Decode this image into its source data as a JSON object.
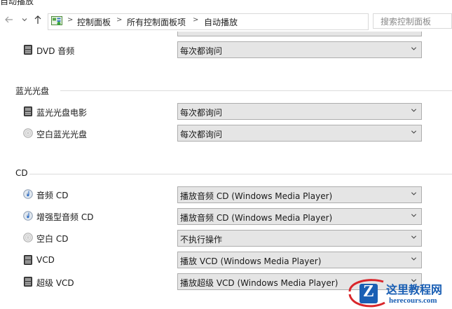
{
  "window": {
    "title_fragment": "自动播放"
  },
  "nav": {
    "back_icon": "back-arrow-icon",
    "forward_icon": "forward-arrow-icon",
    "recent_icon": "chevron-down-icon",
    "up_icon": "up-arrow-icon"
  },
  "address_bar": {
    "crumbs": [
      "控制面板",
      "所有控制面板项",
      "自动播放"
    ]
  },
  "search": {
    "placeholder": "搜索控制面板"
  },
  "sections": {
    "dvd": {
      "rows": [
        {
          "label": "DVD 音频",
          "value": "每次都询问",
          "icon": "dvd-drive-icon"
        }
      ]
    },
    "bluray": {
      "header": "蓝光光盘",
      "rows": [
        {
          "label": "蓝光光盘电影",
          "value": "每次都询问",
          "icon": "disc-drive-icon"
        },
        {
          "label": "空白蓝光光盘",
          "value": "每次都询问",
          "icon": "blank-disc-icon"
        }
      ]
    },
    "cd": {
      "header": "CD",
      "rows": [
        {
          "label": "音频 CD",
          "value": "播放音频 CD (Windows Media Player)",
          "icon": "audio-cd-icon"
        },
        {
          "label": "增强型音频 CD",
          "value": "播放音频 CD (Windows Media Player)",
          "icon": "audio-cd-icon"
        },
        {
          "label": "空白 CD",
          "value": "不执行操作",
          "icon": "blank-disc-icon"
        },
        {
          "label": "VCD",
          "value": "播放 VCD (Windows Media Player)",
          "icon": "disc-drive-icon"
        },
        {
          "label": "超级 VCD",
          "value": "播放超级 VCD (Windows Media Player)",
          "icon": "disc-drive-icon"
        }
      ]
    }
  },
  "watermark": {
    "title": "这里教程网",
    "url": "herecours.com",
    "letter": "Z"
  },
  "colors": {
    "dropdown_bg": "#e5e5e5",
    "dropdown_border": "#adadad",
    "divider": "#dcdcdc",
    "watermark_blue": "#1a5fb4",
    "watermark_red": "#d9262b"
  }
}
